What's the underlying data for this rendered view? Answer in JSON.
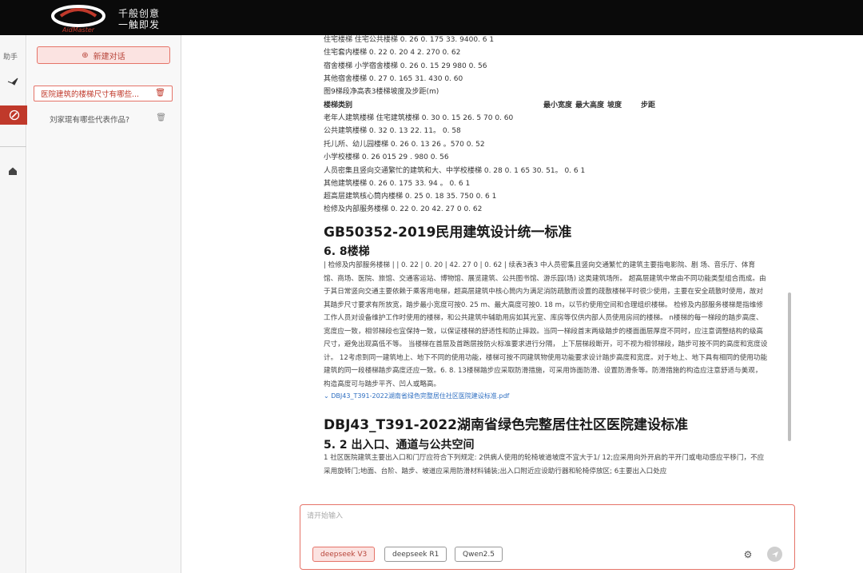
{
  "header": {
    "brand": "AidMaster",
    "slogan_line1": "千般创意",
    "slogan_line2": "一触即发"
  },
  "rail": {
    "label": "助手",
    "icons": [
      "bird-icon",
      "pen-icon",
      "home-icon"
    ]
  },
  "sidebar": {
    "new_chat_label": "新建对话",
    "conversations": [
      {
        "title": "医院建筑的楼梯尺寸有哪些...",
        "active": true
      },
      {
        "title": "刘家琨有哪些代表作品?",
        "active": false
      }
    ]
  },
  "doc": {
    "top_rows": [
      {
        "text": "住宅楼梯                    住宅公共楼梯 0. 26      0. 175    33. 9400. 6 1"
      },
      {
        "text": "住宅套内楼梯                    0. 22                0. 20      4 2. 270 0. 62"
      },
      {
        "text": "宿舍楼梯                    小学宿舍楼梯 0. 26      0. 15      29 980 0. 56"
      },
      {
        "text": "其他宿舍楼梯                    0. 27        0. 165    31. 430  0. 60"
      },
      {
        "text": "图9梯段净高表3楼梯坡度及步距(m)"
      }
    ],
    "table_header": [
      "楼梯类别",
      "最小宽度",
      "最大高度",
      "坡度",
      "步距"
    ],
    "table_rows": [
      {
        "text": "老年人建筑楼梯                                                  住宅建筑楼梯 0. 30      0. 15      26. 5 70  0. 60"
      },
      {
        "text": "公共建筑楼梯                                                     0. 32          0. 13      22. 11。   0. 58"
      },
      {
        "text": "托儿所、幼儿园楼梯                                                                0. 26      0. 13      26 。570 0. 52"
      },
      {
        "text": "小学校楼梯                                                                           0. 26      015        29 . 980  0. 56"
      },
      {
        "text": "人员密集且竖向交通繁忙的建筑和大、中学校楼梯                     0. 28      0. 1 65    30. 51。   0. 6 1"
      },
      {
        "text": "其他建筑楼梯                                                                        0. 26      0. 175     33. 94 。 0. 6 1"
      },
      {
        "text": "超高层建筑核心筒内楼梯                                                      0. 25      0. 18       35. 750  0. 6 1"
      },
      {
        "text": "检修及内部服务楼梯                                                              0. 22      0. 20       42. 27 0  0. 62"
      }
    ],
    "heading1": "GB50352-2019民用建筑设计统一标准",
    "subheading1": "6. 8楼梯",
    "paragraph1": "| 检修及内部服务楼梯 | | 0. 22 | 0. 20 | 42. 27 0 | 0. 62 | 续表3表3 中人员密集且竖向交通繁忙的建筑主要指电影院、剧 场、音乐厅、体育馆、商场、医院、旅馆、交通客运站、博物馆、展览建筑、公共图书馆、游乐园(场) 这类建筑场所。 超高层建筑中常由不同功能类型组合而成。由于其日常竖向交通主要依赖于乘客用电梯，超高层建筑中核心筒内为满足消防疏散而设置的疏散楼梯平时很少使用，主要在安全疏散时使用，故对其踏步尺寸要求有所放宽，踏步最小宽度可按0. 25 m、最大高度可按0. 18 m，以节约使用空间和合理组织楼梯。 检修及内部服务楼梯是指维修工作人员对设备维护工作时使用的楼梯，和公共建筑中辅助用房如其光室、库房等仅供内部人员使用房间的楼梯。 n楼梯的每一梯段的踏步高度、宽度应一致，相邻梯段也宜保持一致，以保证楼梯的舒适性和防止摔跤。当同一梯段首末两级踏步的楼面面层厚度不同时，应注意调整结构的级高尺寸，避免出现高低不等。 当楼梯在首层及首跑层按防火标准要求进行分隔， 上下层梯段断开，可不视为相邻梯段，踏步可按不同的高度和宽度设计。 12考虑到同一建筑地上、地下不同的使用功能，楼梯可按不同建筑物使用功能要求设计踏步高度和宽度。对于地上、地下具有相同的使用功能建筑的同一段楼梯踏步高度还应一致。6. 8. 13楼梯踏步应采取防滑措施，可采用饰面防滑、设置防滑条等。防滑措施的构造应注意舒适与美观，构造高度可与踏步平齐、凹人或略高。",
    "pdf_link": "DBJ43_T391-2022湖南省绿色完整居住社区医院建设标准.pdf",
    "heading2": "DBJ43_T391-2022湖南省绿色完整居住社区医院建设标准",
    "subheading2": "5. 2 出入口、通道与公共空间",
    "paragraph2": "1 社区医院建筑主要出入口和门厅应符合下列规定: 2供病人使用的轮椅坡道坡度不宜大于1/ 12;应采用向外开启的平开门或电动感应平移门，不应采用旋转门;地面、台阶、踏步、坡道应采用防滑材料铺装;出入口附近应设助行器和轮椅停放区; 6主要出入口处应"
  },
  "composer": {
    "placeholder": "请开始输入",
    "models": [
      {
        "label": "deepseek V3",
        "selected": true
      },
      {
        "label": "deepseek R1",
        "selected": false
      },
      {
        "label": "Qwen2.5",
        "selected": false
      }
    ]
  }
}
